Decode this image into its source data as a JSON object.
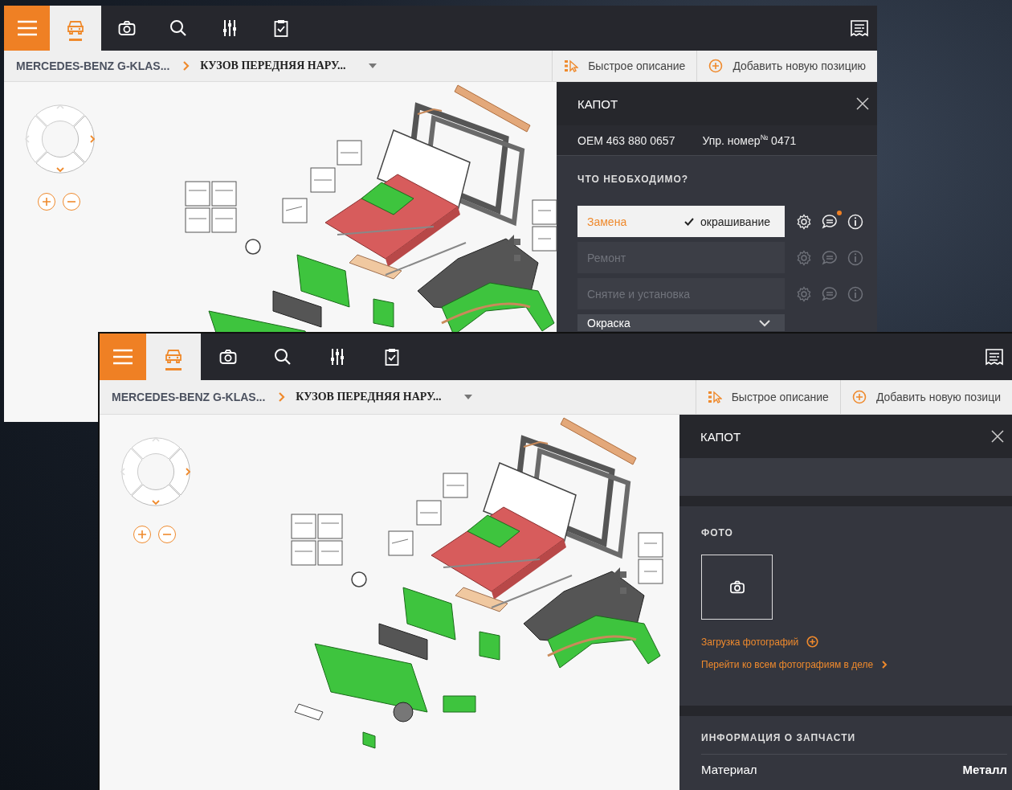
{
  "windows": [
    {
      "toolbar": {
        "tabs": [
          {
            "selected": true
          },
          {
            "selected": false
          },
          {
            "selected": false
          },
          {
            "selected": false
          },
          {
            "selected": false
          }
        ]
      },
      "breadcrumb": {
        "vehicle": "MERCEDES-BENZ G-KLAS...",
        "section": "КУЗОВ ПЕРЕДНЯЯ НАРУ..."
      },
      "actions": [
        {
          "kind": "quick",
          "label": "Быстрое описание"
        },
        {
          "kind": "add",
          "label": "Добавить новую позицию"
        }
      ],
      "panel": {
        "kind": "operations",
        "title": "КАПОТ",
        "oem": "OEM 463 880 0657",
        "ref": "Упр. номер$^{№}$ 0471",
        "heading": "ЧТО НЕОБХОДИМО?",
        "operations": [
          {
            "kind": "action",
            "label": "Замена",
            "note": "окрашивание",
            "selected": true,
            "notification": true
          },
          {
            "kind": "action",
            "label": "Ремонт",
            "selected": false,
            "notification": false
          },
          {
            "kind": "action",
            "label": "Снятие и установка",
            "selected": false,
            "notification": false
          },
          {
            "kind": "dropdown",
            "label": "Окраска"
          }
        ]
      }
    },
    {
      "toolbar": {
        "tabs": [
          {
            "selected": true
          },
          {
            "selected": false
          },
          {
            "selected": false
          },
          {
            "selected": false
          },
          {
            "selected": false
          }
        ]
      },
      "breadcrumb": {
        "vehicle": "MERCEDES-BENZ G-KLAS...",
        "section": "КУЗОВ ПЕРЕДНЯЯ НАРУ..."
      },
      "actions": [
        {
          "kind": "quick",
          "label": "Быстрое описание"
        },
        {
          "kind": "add",
          "label": "Добавить новую позици"
        }
      ],
      "panel": {
        "kind": "photos",
        "title": "КАПОТ",
        "photo_heading": "ФОТО",
        "upload": "Загрузка фотографий",
        "all_photos": "Перейти ко всем фотографиям в деле",
        "info_heading": "ИНФОРМАЦИЯ О ЗАПЧАСТИ",
        "properties": [
          {
            "label": "Материал",
            "value": "Металл"
          }
        ]
      }
    }
  ]
}
